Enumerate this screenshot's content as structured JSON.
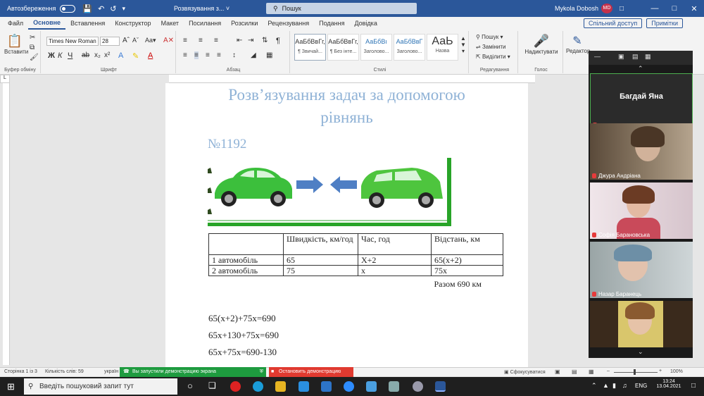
{
  "titlebar": {
    "autosave_label": "Автозбереження",
    "doc_title": "Розвязування з... ˅",
    "search_placeholder": "Пошук",
    "user_name": "Mykola Dobosh",
    "user_initials": "MD"
  },
  "tabs": [
    "Файл",
    "Основне",
    "Вставлення",
    "Конструктор",
    "Макет",
    "Посилання",
    "Розсилки",
    "Рецензування",
    "Подання",
    "Довідка"
  ],
  "active_tab": "Основне",
  "share_label": "Спільний доступ",
  "comments_label": "Примітки",
  "ribbon": {
    "paste_label": "Вставити",
    "clipboard_group": "Буфер обміну",
    "font_name": "Times New Roman",
    "font_size": "28",
    "font_group": "Шрифт",
    "paragraph_group": "Абзац",
    "styles_group": "Стилі",
    "styles": [
      {
        "preview": "АаБбВвГг,",
        "name": "¶ Звичай..."
      },
      {
        "preview": "АаБбВвГг,",
        "name": "¶ Без інте..."
      },
      {
        "preview": "АаБбВı",
        "name": "Заголово..."
      },
      {
        "preview": "АаБбВвГ",
        "name": "Заголово..."
      },
      {
        "preview": "АаЬ",
        "name": "Назва"
      }
    ],
    "find_label": "Пошук",
    "replace_label": "Замінити",
    "select_label": "Виділити",
    "editing_group": "Редагування",
    "dictate_label": "Надиктувати",
    "voice_group": "Голос",
    "editor_label": "Редактор"
  },
  "document": {
    "title_line1": "Розв’язування задач за допомогою",
    "title_line2": "рівнянь",
    "problem_number": "№1192",
    "table": {
      "headers": [
        "",
        "Швидкість, км/год",
        "Час, год",
        "Відстань, км"
      ],
      "rows": [
        [
          "1 автомобіль",
          "65",
          "Х+2",
          "65(х+2)"
        ],
        [
          "2 автомобіль",
          "75",
          "х",
          "75х"
        ]
      ],
      "total": "Разом 690 км"
    },
    "equations": [
      "65(х+2)+75х=690",
      "65х+130+75х=690",
      "65х+75х=690-130"
    ]
  },
  "statusbar": {
    "page": "Сторінка 1 із 3",
    "words": "Кількість слів: 59",
    "lang": "україн",
    "focus": "Сфокусуватися",
    "zoom": "100%"
  },
  "screenshare": {
    "green_text": "Вы запустили демонстрацию экрана",
    "red_text": "Остановить демонстрацию"
  },
  "zoom_panel": {
    "participants": [
      {
        "name": "Багдай Яна",
        "video": false
      },
      {
        "name": "Джура Андріана",
        "video": true
      },
      {
        "name": "Софія Барановська",
        "video": true
      },
      {
        "name": "Назар Баранець",
        "video": true
      },
      {
        "name": "",
        "video": true
      }
    ]
  },
  "taskbar": {
    "search_placeholder": "Введіть пошуковий запит тут",
    "lang": "ENG",
    "time": "13:24",
    "date": "13.04.2021"
  }
}
